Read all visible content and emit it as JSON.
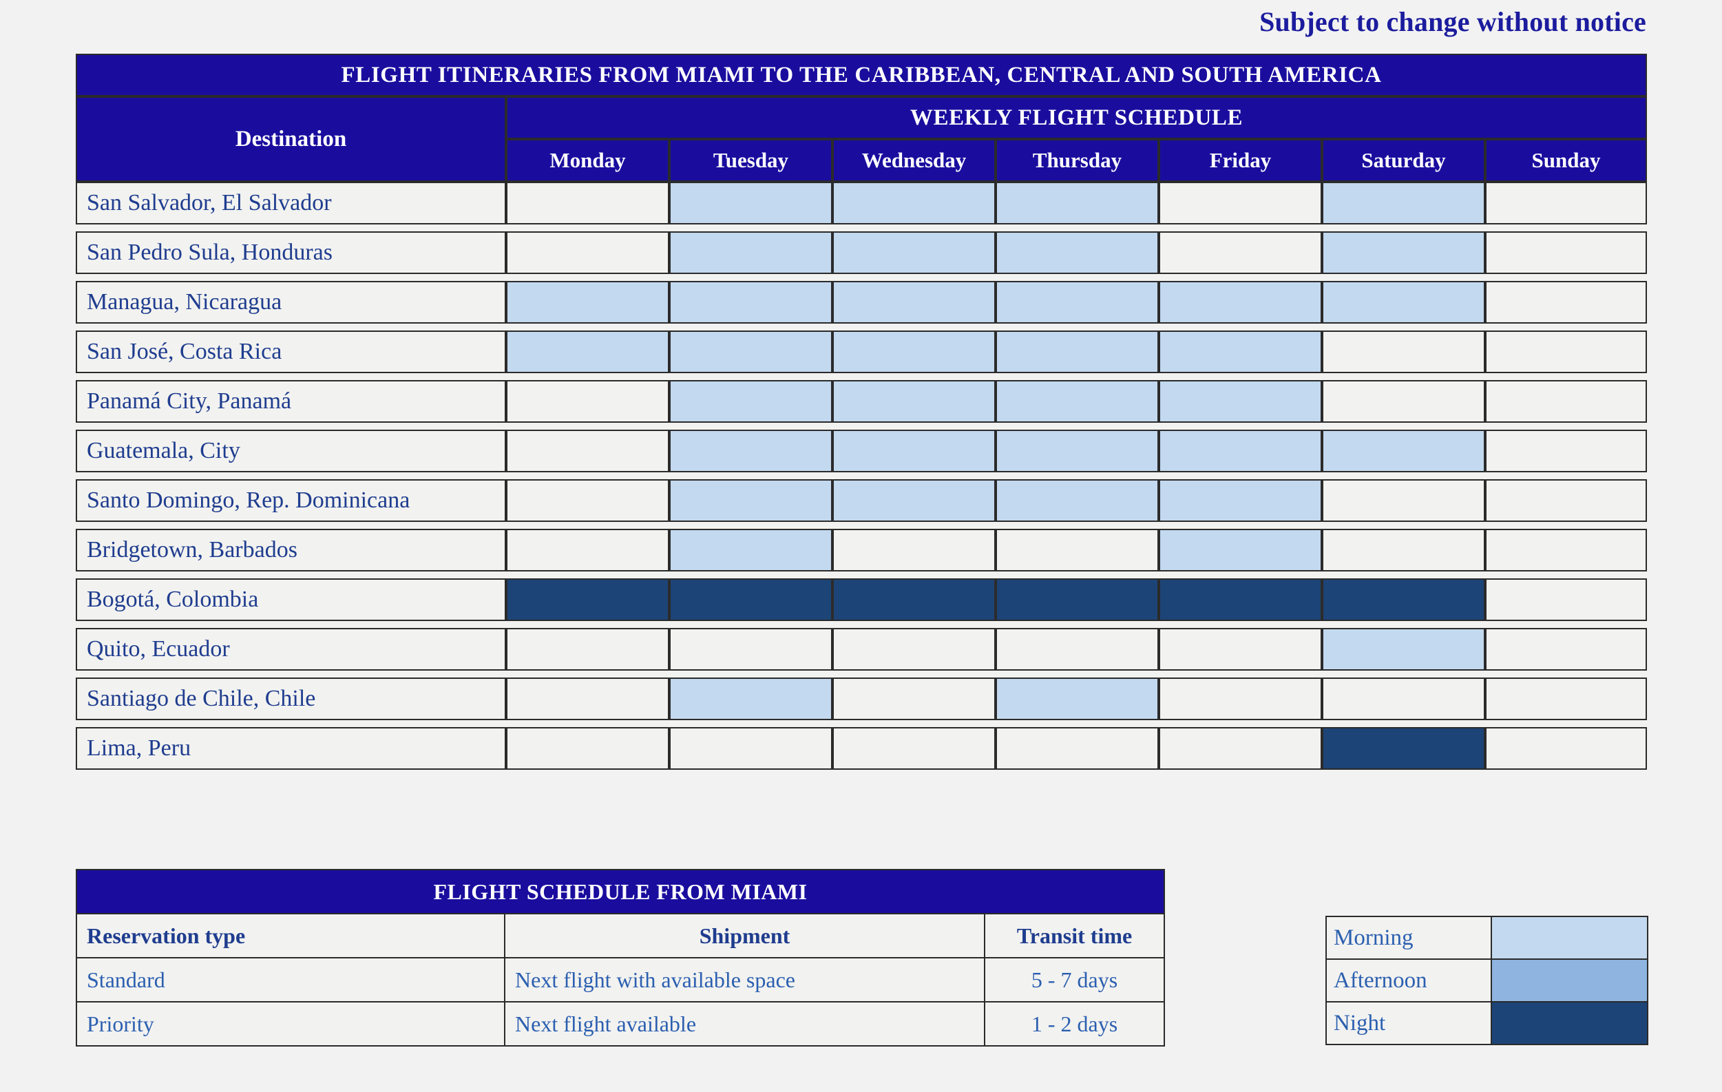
{
  "notice": "Subject to change without notice",
  "main_table": {
    "title": "FLIGHT ITINERARIES FROM MIAMI TO THE CARIBBEAN, CENTRAL AND SOUTH AMERICA",
    "destination_header": "Destination",
    "schedule_header": "WEEKLY FLIGHT SCHEDULE",
    "days": [
      "Monday",
      "Tuesday",
      "Wednesday",
      "Thursday",
      "Friday",
      "Saturday",
      "Sunday"
    ],
    "rows": [
      {
        "destination": "San Salvador, El Salvador",
        "cells": [
          "none",
          "morning",
          "morning",
          "morning",
          "none",
          "morning",
          "none"
        ]
      },
      {
        "destination": "San Pedro Sula, Honduras",
        "cells": [
          "none",
          "morning",
          "morning",
          "morning",
          "none",
          "morning",
          "none"
        ]
      },
      {
        "destination": "Managua, Nicaragua",
        "cells": [
          "morning",
          "morning",
          "morning",
          "morning",
          "morning",
          "morning",
          "none"
        ]
      },
      {
        "destination": "San José, Costa Rica",
        "cells": [
          "morning",
          "morning",
          "morning",
          "morning",
          "morning",
          "none",
          "none"
        ]
      },
      {
        "destination": "Panamá City, Panamá",
        "cells": [
          "none",
          "morning",
          "morning",
          "morning",
          "morning",
          "none",
          "none"
        ]
      },
      {
        "destination": "Guatemala, City",
        "cells": [
          "none",
          "morning",
          "morning",
          "morning",
          "morning",
          "morning",
          "none"
        ]
      },
      {
        "destination": "Santo Domingo, Rep. Dominicana",
        "cells": [
          "none",
          "morning",
          "morning",
          "morning",
          "morning",
          "none",
          "none"
        ]
      },
      {
        "destination": "Bridgetown, Barbados",
        "cells": [
          "none",
          "morning",
          "none",
          "none",
          "morning",
          "none",
          "none"
        ]
      },
      {
        "destination": "Bogotá, Colombia",
        "cells": [
          "night",
          "night",
          "night",
          "night",
          "night",
          "night",
          "none"
        ]
      },
      {
        "destination": "Quito, Ecuador",
        "cells": [
          "none",
          "none",
          "none",
          "none",
          "none",
          "morning",
          "none"
        ]
      },
      {
        "destination": "Santiago de Chile, Chile",
        "cells": [
          "none",
          "morning",
          "none",
          "morning",
          "none",
          "none",
          "none"
        ]
      },
      {
        "destination": "Lima, Peru",
        "cells": [
          "none",
          "none",
          "none",
          "none",
          "none",
          "night",
          "none"
        ]
      }
    ]
  },
  "info_table": {
    "title": "FLIGHT SCHEDULE FROM MIAMI",
    "headers": [
      "Reservation type",
      "Shipment",
      "Transit time"
    ],
    "rows": [
      {
        "type": "Standard",
        "shipment": "Next flight with available space",
        "transit": "5 - 7 days"
      },
      {
        "type": "Priority",
        "shipment": "Next flight available",
        "transit": "1 - 2 days"
      }
    ]
  },
  "legend": {
    "items": [
      {
        "label": "Morning",
        "color": "#c3d9ef"
      },
      {
        "label": "Afternoon",
        "color": "#8fb4e0"
      },
      {
        "label": "Night",
        "color": "#1d4477"
      }
    ]
  }
}
